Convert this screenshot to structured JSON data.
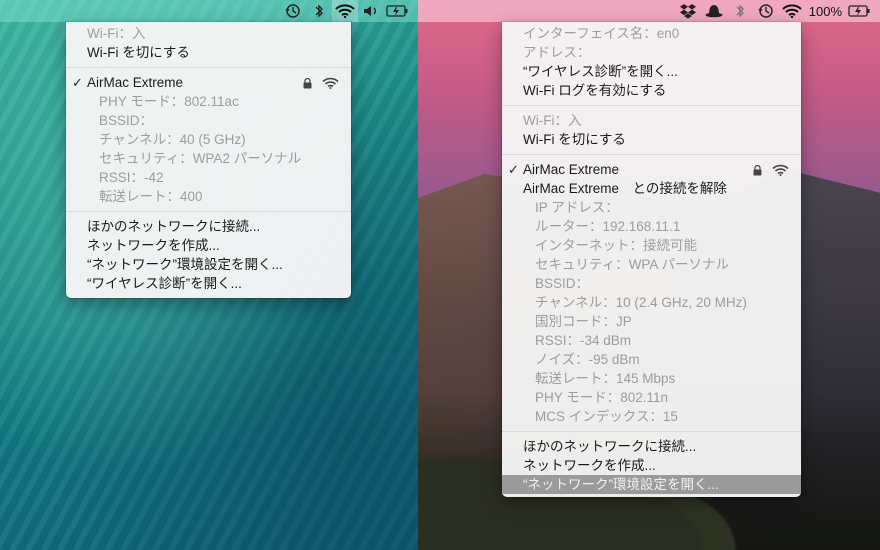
{
  "left": {
    "menubar": {
      "icons": [
        "time-machine-icon",
        "bluetooth-icon",
        "wifi-icon",
        "volume-icon",
        "battery-icon"
      ]
    },
    "menu": {
      "wifi_status": "Wi-Fi：入",
      "wifi_toggle": "Wi-Fi を切にする",
      "network_name": "AirMac Extreme",
      "details": [
        "PHY モード：802.11ac",
        "BSSID：",
        "チャンネル：40 (5 GHz)",
        "セキュリティ：WPA2 パーソナル",
        "RSSI：-42",
        "転送レート：400"
      ],
      "actions": [
        "ほかのネットワークに接続...",
        "ネットワークを作成...",
        "“ネットワーク”環境設定を開く...",
        "“ワイヤレス診断”を開く..."
      ]
    }
  },
  "right": {
    "menubar": {
      "icons": [
        "dropbox-icon",
        "bowler-hat-icon",
        "bluetooth-icon",
        "time-machine-icon",
        "wifi-icon"
      ],
      "battery_percent": "100%"
    },
    "menu": {
      "info": [
        "インターフェイス名：en0",
        "アドレス："
      ],
      "tools": [
        "“ワイヤレス診断”を開く...",
        "Wi-Fi ログを有効にする"
      ],
      "wifi_status": "Wi-Fi：入",
      "wifi_toggle": "Wi-Fi を切にする",
      "network_name": "AirMac Extreme",
      "disconnect": "AirMac Extreme　との接続を解除",
      "details": [
        "IP アドレス：",
        "ルーター：192.168.11.1",
        "インターネット：接続可能",
        "セキュリティ：WPA パーソナル",
        "BSSID：",
        "チャンネル：10 (2.4 GHz, 20 MHz)",
        "国別コード：JP",
        "RSSI：-34 dBm",
        "ノイズ：-95 dBm",
        "転送レート：145 Mbps",
        "PHY モード：802.11n",
        "MCS インデックス：15"
      ],
      "actions": [
        "ほかのネットワークに接続...",
        "ネットワークを作成...",
        "“ネットワーク”環境設定を開く..."
      ]
    }
  }
}
